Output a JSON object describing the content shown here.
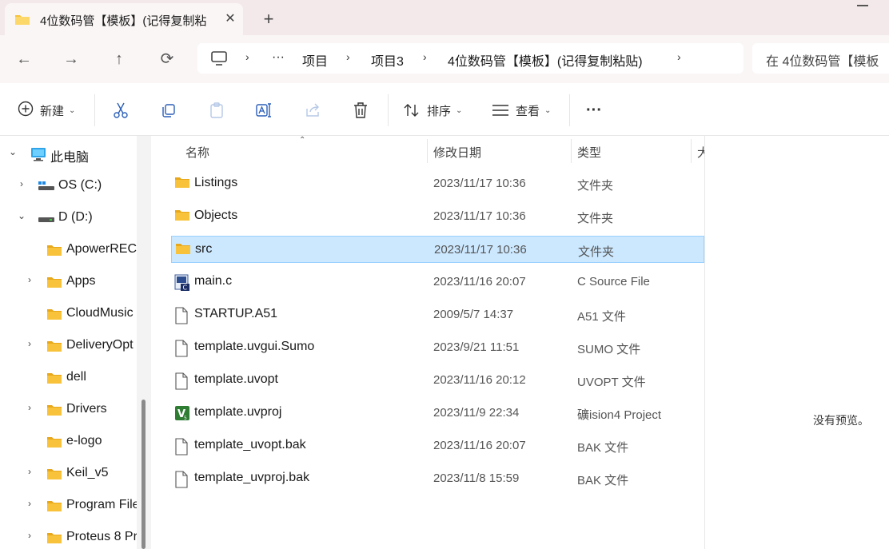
{
  "tab": {
    "title": "4位数码管【模板】(记得复制粘",
    "close": "✕",
    "new_tab": "+"
  },
  "nav": {
    "back": "←",
    "forward": "→",
    "up": "↑",
    "refresh": "⟳"
  },
  "address": {
    "more": "···",
    "segments": [
      "项目",
      "项目3",
      "4位数码管【模板】(记得复制粘贴)"
    ]
  },
  "search": {
    "placeholder": "在 4位数码管【模板"
  },
  "commands": {
    "new": "新建",
    "sort": "排序",
    "view": "查看",
    "more": "···"
  },
  "sidebar": {
    "items": [
      {
        "label": "此电脑",
        "expanded": true,
        "icon": "computer-icon"
      },
      {
        "label": "OS (C:)",
        "expanded": false,
        "icon": "drive-icon"
      },
      {
        "label": "D (D:)",
        "expanded": true,
        "icon": "drive-icon"
      },
      {
        "label": "ApowerREC",
        "icon": "folder-icon"
      },
      {
        "label": "Apps",
        "icon": "folder-icon"
      },
      {
        "label": "CloudMusic",
        "icon": "folder-icon"
      },
      {
        "label": "DeliveryOpt",
        "icon": "folder-icon"
      },
      {
        "label": "dell",
        "icon": "folder-icon"
      },
      {
        "label": "Drivers",
        "icon": "folder-icon"
      },
      {
        "label": "e-logo",
        "icon": "folder-icon"
      },
      {
        "label": "Keil_v5",
        "icon": "folder-icon"
      },
      {
        "label": "Program File",
        "icon": "folder-icon"
      },
      {
        "label": "Proteus 8 Pr",
        "icon": "folder-icon"
      }
    ]
  },
  "columns": {
    "name": "名称",
    "modified": "修改日期",
    "type": "类型",
    "size": "大"
  },
  "files": [
    {
      "name": "Listings",
      "date": "2023/11/17 10:36",
      "type": "文件夹",
      "icon": "folder-icon"
    },
    {
      "name": "Objects",
      "date": "2023/11/17 10:36",
      "type": "文件夹",
      "icon": "folder-icon"
    },
    {
      "name": "src",
      "date": "2023/11/17 10:36",
      "type": "文件夹",
      "icon": "folder-icon",
      "selected": true
    },
    {
      "name": "main.c",
      "date": "2023/11/16 20:07",
      "type": "C Source File",
      "icon": "c-source-file-icon"
    },
    {
      "name": "STARTUP.A51",
      "date": "2009/5/7 14:37",
      "type": "A51 文件",
      "icon": "file-icon"
    },
    {
      "name": "template.uvgui.Sumo",
      "date": "2023/9/21 11:51",
      "type": "SUMO 文件",
      "icon": "file-icon"
    },
    {
      "name": "template.uvopt",
      "date": "2023/11/16 20:12",
      "type": "UVOPT 文件",
      "icon": "file-icon"
    },
    {
      "name": "template.uvproj",
      "date": "2023/11/9 22:34",
      "type": "礦ision4 Project",
      "icon": "keil-project-icon"
    },
    {
      "name": "template_uvopt.bak",
      "date": "2023/11/16 20:07",
      "type": "BAK 文件",
      "icon": "file-icon"
    },
    {
      "name": "template_uvproj.bak",
      "date": "2023/11/8 15:59",
      "type": "BAK 文件",
      "icon": "file-icon"
    }
  ],
  "preview": {
    "message": "没有预览。"
  },
  "colors": {
    "accent": "#0067c0",
    "selection": "#cce8ff",
    "titlebar": "#f3e9ea",
    "folder": "#f8c33a"
  }
}
